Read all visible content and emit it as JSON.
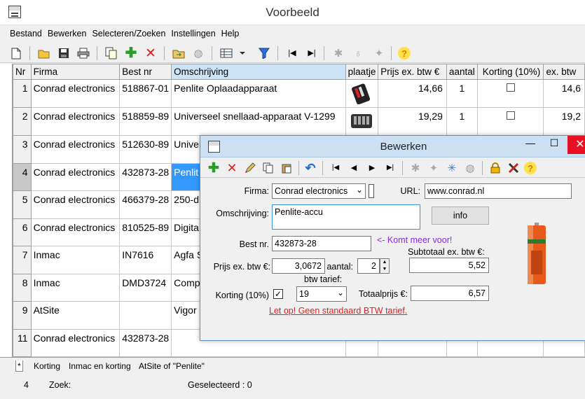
{
  "window": {
    "title": "Voorbeeld"
  },
  "menu": [
    "Bestand",
    "Bewerken",
    "Selecteren/Zoeken",
    "Instellingen",
    "Help"
  ],
  "toolbar_icons": [
    "new-file-icon",
    "open-folder-icon",
    "save-icon",
    "print-icon",
    "copy-icon",
    "add-icon",
    "delete-icon",
    "import-icon",
    "globe-icon",
    "table-icon",
    "filter-icon",
    "first-record-icon",
    "last-record-icon",
    "star-icon",
    "bulb-icon",
    "sparkle-icon",
    "help-icon"
  ],
  "grid": {
    "columns": [
      "Nr",
      "Firma",
      "Best nr",
      "Omschrijving",
      "plaatje",
      "Prijs ex. btw €",
      "aantal",
      "Korting (10%)",
      "ex. btw"
    ],
    "rows": [
      {
        "nr": "1",
        "firma": "Conrad electronics",
        "best_nr": "518867-01",
        "omschrijving": "Penlite Oplaadapparaat",
        "prijs": "14,66",
        "aantal": "1",
        "korting": false,
        "exbtw": "14,6"
      },
      {
        "nr": "2",
        "firma": "Conrad electronics",
        "best_nr": "518859-89",
        "omschrijving": "Universeel snellaad-apparaat V-1299",
        "prijs": "19,29",
        "aantal": "1",
        "korting": false,
        "exbtw": "19,2"
      },
      {
        "nr": "3",
        "firma": "Conrad electronics",
        "best_nr": "512630-89",
        "omschrijving": "Univer",
        "prijs": "",
        "aantal": "",
        "korting": null,
        "exbtw": ""
      },
      {
        "nr": "4",
        "firma": "Conrad electronics",
        "best_nr": "432873-28",
        "omschrijving": "Penlit",
        "prijs": "",
        "aantal": "",
        "korting": null,
        "exbtw": ""
      },
      {
        "nr": "5",
        "firma": "Conrad electronics",
        "best_nr": "466379-28",
        "omschrijving": "250-d",
        "prijs": "",
        "aantal": "",
        "korting": null,
        "exbtw": ""
      },
      {
        "nr": "6",
        "firma": "Conrad electronics",
        "best_nr": "810525-89",
        "omschrijving": "Digita W",
        "prijs": "",
        "aantal": "",
        "korting": null,
        "exbtw": ""
      },
      {
        "nr": "7",
        "firma": "Inmac",
        "best_nr": "IN7616",
        "omschrijving": "Agfa S Flatbe",
        "prijs": "",
        "aantal": "",
        "korting": null,
        "exbtw": ""
      },
      {
        "nr": "8",
        "firma": "Inmac",
        "best_nr": "DMD3724",
        "omschrijving": "Comp 33960",
        "prijs": "",
        "aantal": "",
        "korting": null,
        "exbtw": ""
      },
      {
        "nr": "9",
        "firma": "AtSite",
        "best_nr": "",
        "omschrijving": "Vigor MxStr",
        "prijs": "",
        "aantal": "",
        "korting": null,
        "exbtw": ""
      },
      {
        "nr": "11",
        "firma": "Conrad electronics",
        "best_nr": "432873-28",
        "omschrijving": "",
        "prijs": "",
        "aantal": "",
        "korting": null,
        "exbtw": ""
      }
    ]
  },
  "tabs": [
    "*",
    "Korting",
    "Inmac en korting",
    "AtSite of \"Penlite\""
  ],
  "status": {
    "record": "4",
    "zoek": "Zoek:",
    "geselecteerd": "Geselecteerd : 0"
  },
  "dialog": {
    "title": "Bewerken",
    "firma_label": "Firma:",
    "firma_value": "Conrad electronics",
    "url_label": "URL:",
    "url_value": "www.conrad.nl",
    "omschrijving_label": "Omschrijving:",
    "omschrijving_value": "Penlite-accu",
    "info_button": "info",
    "bestnr_label": "Best nr.",
    "bestnr_value": "432873-28",
    "hint": "<- Komt meer voor!",
    "subtotaal_label": "Subtotaal ex. btw €:",
    "subtotaal_value": "5,52",
    "prijs_label": "Prijs ex. btw €:",
    "prijs_value": "3,0672",
    "aantal_label": "aantal:",
    "aantal_value": "2",
    "btw_label": "btw tarief:",
    "korting_label": "Korting (10%)",
    "korting_checked": true,
    "btw_value": "19",
    "totaal_label": "Totaalprijs €:",
    "totaal_value": "6,57",
    "warning": "Let op! Geen standaard BTW tarief."
  }
}
